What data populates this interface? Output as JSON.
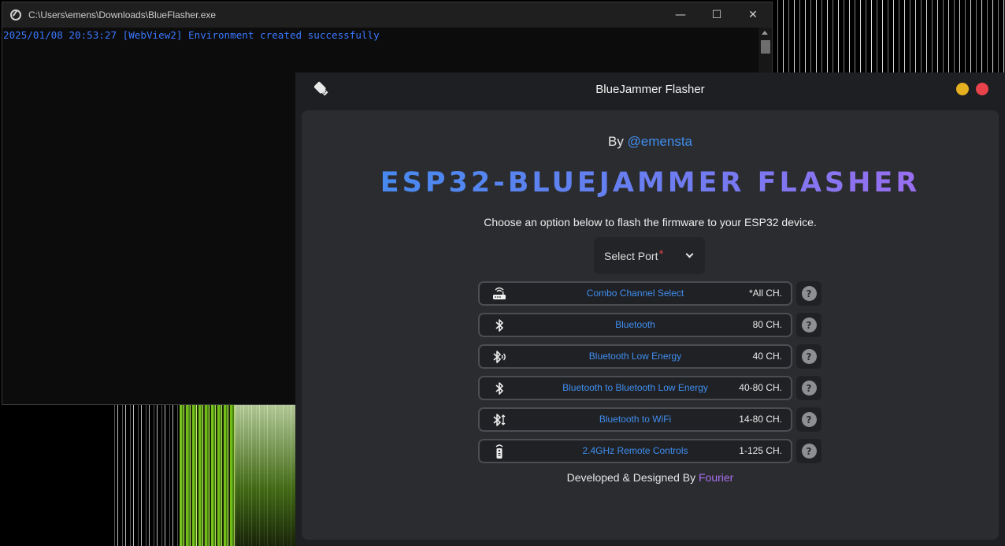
{
  "console": {
    "title": "C:\\Users\\emens\\Downloads\\BlueFlasher.exe",
    "minimize": "—",
    "maximize": "☐",
    "close": "✕",
    "log": "2025/01/08 20:53:27 [WebView2] Environment created successfully"
  },
  "app": {
    "title": "BlueJammer Flasher",
    "by_prefix": "By ",
    "author": "@emensta",
    "heading": "ESP32-BLUEJAMMER FLASHER",
    "subtitle": "Choose an option below to flash the firmware to your ESP32 device.",
    "select_port": {
      "label": "Select Port",
      "required": "*"
    },
    "options": [
      {
        "icon": "router-icon",
        "label": "Combo Channel Select",
        "channels": "*All CH."
      },
      {
        "icon": "bluetooth-icon",
        "label": "Bluetooth",
        "channels": "80 CH."
      },
      {
        "icon": "bluetooth-audio-icon",
        "label": "Bluetooth Low Energy",
        "channels": "40 CH."
      },
      {
        "icon": "bluetooth-icon",
        "label": "Bluetooth to Bluetooth Low Energy",
        "channels": "40-80 CH."
      },
      {
        "icon": "bluetooth-transfer-icon",
        "label": "Bluetooth to WiFi",
        "channels": "14-80 CH."
      },
      {
        "icon": "remote-control-icon",
        "label": "2.4GHz Remote Controls",
        "channels": "1-125 CH."
      }
    ],
    "help_glyph": "?",
    "footer_prefix": "Developed & Designed By ",
    "footer_name": "Fourier"
  },
  "colors": {
    "accent_blue": "#3f8ef0",
    "accent_purple": "#a970f0",
    "window_min": "#e5b01f",
    "window_close": "#e8424b",
    "console_text": "#3b78ff"
  }
}
